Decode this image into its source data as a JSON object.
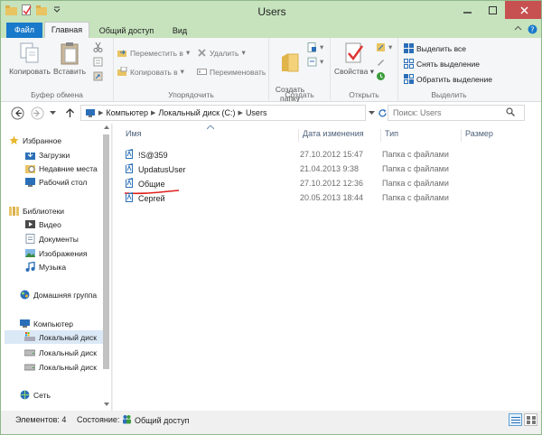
{
  "window": {
    "title": "Users"
  },
  "tabs": {
    "file": "Файл",
    "home": "Главная",
    "share": "Общий доступ",
    "view": "Вид"
  },
  "ribbon": {
    "clipboard": {
      "label": "Буфер обмена",
      "copy": "Копировать",
      "paste": "Вставить"
    },
    "organize": {
      "label": "Упорядочить",
      "move_to": "Переместить в",
      "copy_to": "Копировать в",
      "delete": "Удалить",
      "rename": "Переименовать"
    },
    "new": {
      "label": "Создать",
      "new_folder": "Создать\nпапку"
    },
    "open": {
      "label": "Открыть",
      "properties": "Свойства"
    },
    "select": {
      "label": "Выделить",
      "select_all": "Выделить все",
      "select_none": "Снять выделение",
      "invert": "Обратить выделение"
    }
  },
  "address": {
    "crumbs": [
      "Компьютер",
      "Локальный диск (C:)",
      "Users"
    ],
    "search_placeholder": "Поиск: Users"
  },
  "navpane": {
    "favorites": "Избранное",
    "downloads": "Загрузки",
    "recent": "Недавние места",
    "desktop": "Рабочий стол",
    "libraries": "Библиотеки",
    "video": "Видео",
    "documents": "Документы",
    "images": "Изображения",
    "music": "Музыка",
    "homegroup": "Домашняя группа",
    "computer": "Компьютер",
    "disk1": "Локальный диск",
    "disk2": "Локальный диск",
    "disk3": "Локальный диск",
    "network": "Сеть"
  },
  "columns": {
    "name": "Имя",
    "date": "Дата изменения",
    "type": "Тип",
    "size": "Размер"
  },
  "files": [
    {
      "name": "!S@359",
      "date": "27.10.2012 15:47",
      "type": "Папка с файлами"
    },
    {
      "name": "UpdatusUser",
      "date": "21.04.2013 9:38",
      "type": "Папка с файлами"
    },
    {
      "name": "Общие",
      "date": "27.10.2012 12:36",
      "type": "Папка с файлами"
    },
    {
      "name": "Сергей",
      "date": "20.05.2013 18:44",
      "type": "Папка с файлами"
    }
  ],
  "status": {
    "items": "Элементов: 4",
    "state_label": "Состояние:",
    "state_value": "Общий доступ"
  },
  "colors": {
    "file_tab": "#1979ca",
    "titlebar": "#c6e3bd",
    "close": "#c75050",
    "annotation": "#e0201b"
  }
}
